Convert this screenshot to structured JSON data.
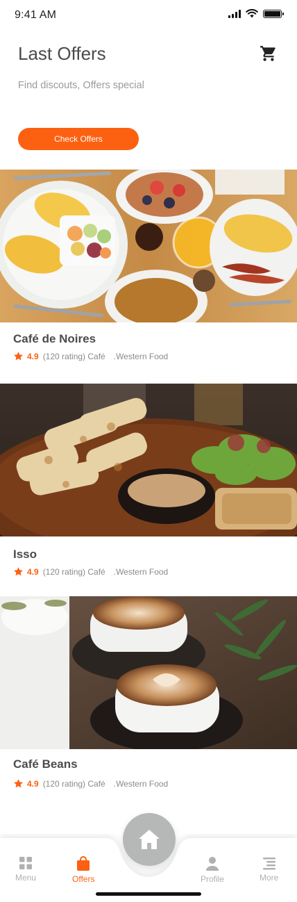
{
  "status_bar": {
    "time": "9:41 AM"
  },
  "header": {
    "title": "Last Offers",
    "subtitle": "Find discouts, Offers special",
    "cta_label": "Check Offers",
    "cart_icon": "cart-icon"
  },
  "offers": [
    {
      "name": "Café de Noires",
      "rating": "4.9",
      "rating_count": "(120 rating) Café",
      "cuisine": ".Western Food"
    },
    {
      "name": "Isso",
      "rating": "4.9",
      "rating_count": "(120 rating) Café",
      "cuisine": ".Western Food"
    },
    {
      "name": "Café Beans",
      "rating": "4.9",
      "rating_count": "(120 rating) Café",
      "cuisine": ".Western Food"
    }
  ],
  "tabs": [
    {
      "label": "Menu",
      "icon": "grid-icon"
    },
    {
      "label": "Offers",
      "icon": "shopping-bag-icon",
      "active": true
    },
    {
      "label": "Profile",
      "icon": "user-icon"
    },
    {
      "label": "More",
      "icon": "menu-lines-icon"
    }
  ],
  "home_icon": "home-icon",
  "colors": {
    "accent": "#fc6011",
    "text": "#4a4b4d",
    "muted": "#9a9a9a",
    "inactive": "#b0b0b0",
    "home_bg": "#b6b7b7"
  }
}
